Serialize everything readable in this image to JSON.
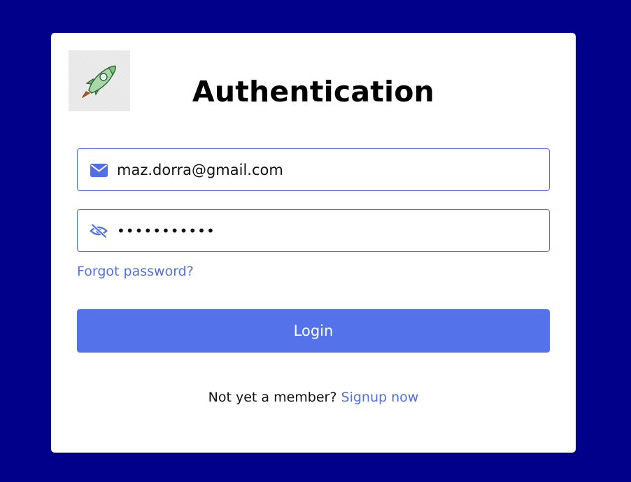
{
  "page": {
    "background_color": "#00008b",
    "accent_color": "#5170e8"
  },
  "card": {
    "logo_icon": "rocket-icon",
    "title": "Authentication"
  },
  "email_field": {
    "icon": "envelope-icon",
    "value": "maz.dorra@gmail.com",
    "type": "email"
  },
  "password_field": {
    "icon": "eye-slash-icon",
    "value": "•••••••••••",
    "type": "password"
  },
  "forgot_password": {
    "label": "Forgot password?"
  },
  "login_button": {
    "label": "Login",
    "color": "#5472ea"
  },
  "signup": {
    "prompt": "Not yet a member?",
    "link_label": "Signup now"
  }
}
